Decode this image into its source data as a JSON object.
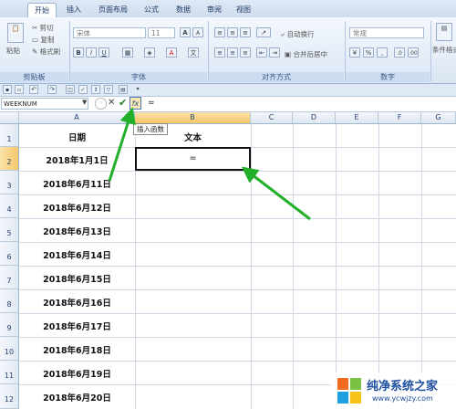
{
  "tabs": [
    "开始",
    "插入",
    "页面布局",
    "公式",
    "数据",
    "审阅",
    "视图"
  ],
  "active_tab": "开始",
  "ribbon": {
    "clipboard": {
      "paste": "粘贴",
      "cut": "剪切",
      "copy": "复制",
      "format_painter": "格式刷",
      "title": "剪贴板"
    },
    "font": {
      "name": "宋体",
      "size": "11",
      "bold": "B",
      "italic": "I",
      "underline": "U",
      "grow": "A",
      "shrink": "A",
      "title": "字体"
    },
    "alignment": {
      "wrap": "自动换行",
      "merge": "合并后居中",
      "title": "对齐方式"
    },
    "number": {
      "format": "常规",
      "percent": "%",
      "comma": ",",
      "title": "数字"
    },
    "styles": {
      "cond": "条件格式"
    }
  },
  "formula_bar": {
    "name_box": "WEEKNUM",
    "fx": "fx",
    "content": "="
  },
  "tooltip": "插入函数",
  "columns": [
    "A",
    "B",
    "C",
    "D",
    "E",
    "F",
    "G"
  ],
  "rows": [
    "1",
    "2",
    "3",
    "4",
    "5",
    "6",
    "7",
    "8",
    "9",
    "10",
    "11",
    "12"
  ],
  "cells": {
    "A1": "日期",
    "B1": "文本",
    "B2": "=",
    "A2": "2018年1月1日",
    "A3": "2018年6月11日",
    "A4": "2018年6月12日",
    "A5": "2018年6月13日",
    "A6": "2018年6月14日",
    "A7": "2018年6月15日",
    "A8": "2018年6月16日",
    "A9": "2018年6月17日",
    "A10": "2018年6月18日",
    "A11": "2018年6月19日",
    "A12": "2018年6月20日"
  },
  "watermark": {
    "title": "纯净系统之家",
    "url": "www.ycwjzy.com"
  },
  "colors": {
    "arrow": "#22b02a",
    "accent": "#2a4d86"
  }
}
